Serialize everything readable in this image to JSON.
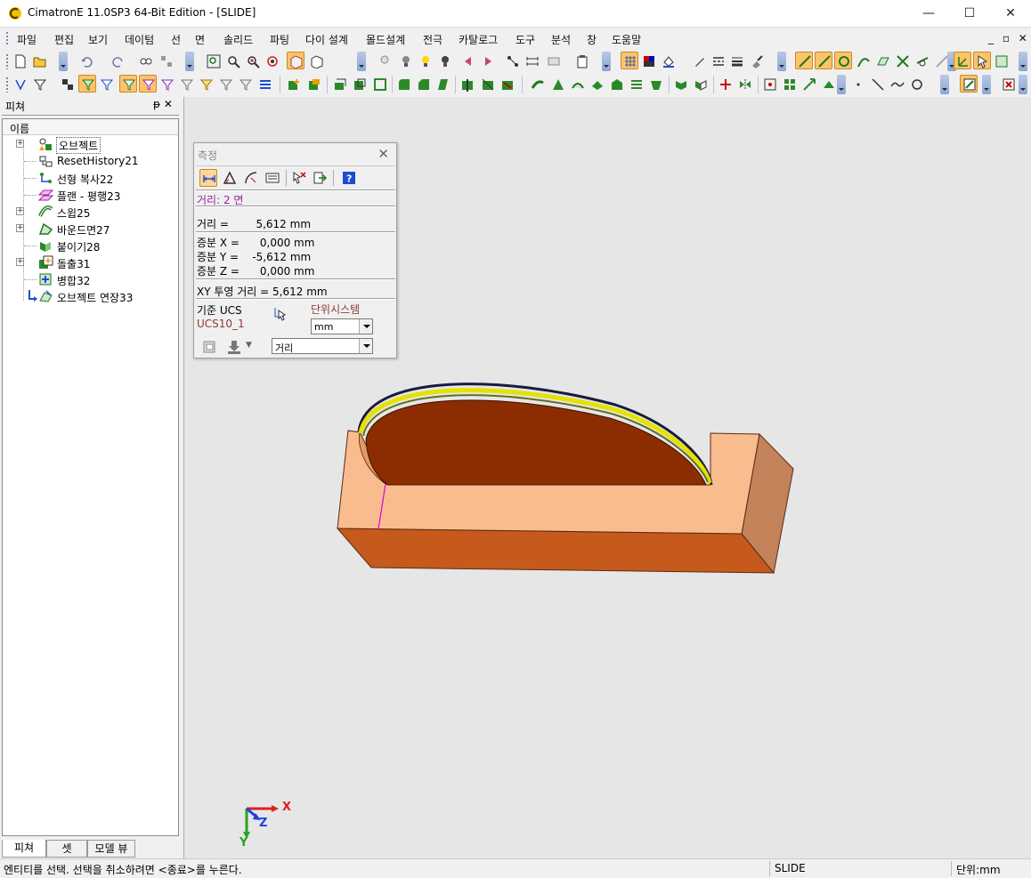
{
  "window": {
    "title": "CimatronE 11.0SP3 64-Bit Edition - [SLIDE]",
    "controls": {
      "minimize": "—",
      "maximize": "☐",
      "close": "✕"
    }
  },
  "menu": {
    "items": [
      "파일",
      "편집",
      "보기",
      "데이텀",
      "선",
      "면",
      "솔리드",
      "파팅",
      "다이 설계",
      "몰드설계",
      "전극",
      "카탈로그",
      "도구",
      "분석",
      "창",
      "도움말"
    ],
    "mdi_controls": "_ ▫ ✕"
  },
  "feature_panel": {
    "title": "피쳐",
    "pin_close": "ᵽ ✕",
    "column_header": "이름",
    "tree": [
      {
        "label": "오브젝트",
        "icon": "objects-icon",
        "expandable": true
      },
      {
        "label": "ResetHistory21",
        "icon": "reset-history-icon",
        "expandable": false
      },
      {
        "label": "선형 복사22",
        "icon": "linear-copy-icon",
        "expandable": false
      },
      {
        "label": "플랜 - 평행23",
        "icon": "plane-parallel-icon",
        "expandable": false
      },
      {
        "label": "스윕25",
        "icon": "sweep-icon",
        "expandable": true
      },
      {
        "label": "바운드면27",
        "icon": "bounded-face-icon",
        "expandable": true
      },
      {
        "label": "붙이기28",
        "icon": "attach-icon",
        "expandable": false
      },
      {
        "label": "돌출31",
        "icon": "extrude-icon",
        "expandable": true
      },
      {
        "label": "병합32",
        "icon": "merge-icon",
        "expandable": false
      },
      {
        "label": "오브젝트 연장33",
        "icon": "object-extend-icon",
        "expandable": false
      }
    ],
    "tabs": [
      "피쳐",
      "셋",
      "모델 뷰"
    ]
  },
  "measure_dialog": {
    "title": "측정",
    "mode_label": "거리:  2 면",
    "distance": "거리 =        5,612 mm",
    "dx": "증분 X =      0,000 mm",
    "dy": "증분 Y =    -5,612 mm",
    "dz": "증분 Z =      0,000 mm",
    "xy_projection": "XY 투영 거리 = 5,612 mm",
    "base_ucs_label": "기준 UCS",
    "base_ucs_value": "UCS10_1",
    "unit_system_label": "단위시스템",
    "unit_value": "mm",
    "measure_type_value": "거리",
    "colors": {
      "mode": "#9b1fa0",
      "ucs_value": "#8b3a3a",
      "unit_label": "#8b3a3a"
    }
  },
  "axis_triad": {
    "x": "X",
    "y": "Y",
    "z": "Z"
  },
  "status": {
    "message": "엔티티를 선택. 선택을 취소하려면 <종료>를 누른다.",
    "document": "SLIDE",
    "unit": "단위:mm"
  },
  "colors": {
    "model_top": "#f9bc8f",
    "model_front": "#c55a1c",
    "model_side": "#c4825b",
    "pocket": "#8b2d00",
    "edge_highlight": "#e5e100",
    "active_button": "#fdc36b"
  }
}
